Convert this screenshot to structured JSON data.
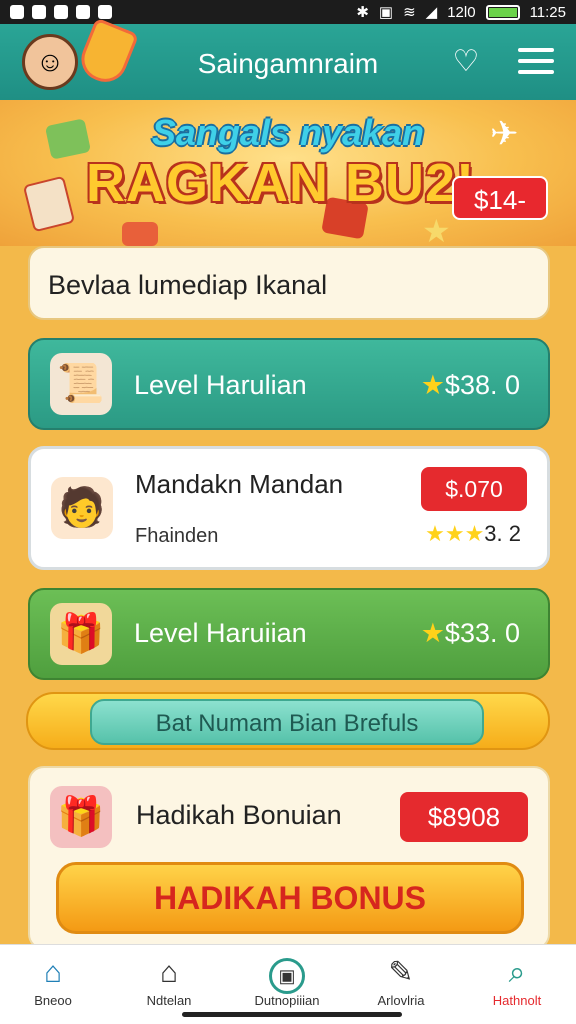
{
  "status_bar": {
    "signal_text": "12l0",
    "time": "11:25"
  },
  "app_bar": {
    "title": "Saingamnraim"
  },
  "banner": {
    "subtitle": "Sangals nyakan",
    "title": "RAGKAN BU2!",
    "price": "$14-"
  },
  "input": {
    "value": "Bevlaa lumediap  Ikanal"
  },
  "rows": [
    {
      "label": "Level Harulian",
      "value": "$38. 0"
    },
    {
      "title": "Mandakn Mandan",
      "subtitle": "Fhainden",
      "price": "$.070",
      "rating": "3. 2"
    },
    {
      "label": "Level Haruiian",
      "value": "$33. 0"
    }
  ],
  "action_pill": {
    "label": "Bat Numam Bian Brefuls"
  },
  "bonus": {
    "label": "Hadikah Bonuian",
    "price": "$8908",
    "button": "HADIKAH BONUS"
  },
  "nav": [
    {
      "label": "Bneoo",
      "icon": "home-icon"
    },
    {
      "label": "Ndtelan",
      "icon": "house-outline-icon"
    },
    {
      "label": "Dutnopiiian",
      "icon": "camera-icon"
    },
    {
      "label": "Arlovlria",
      "icon": "edit-icon"
    },
    {
      "label": "Hathnolt",
      "icon": "search-icon"
    }
  ],
  "colors": {
    "teal": "#2aa596",
    "green": "#4f9f3e",
    "red": "#e52a2e",
    "orange": "#f6ad1a"
  }
}
